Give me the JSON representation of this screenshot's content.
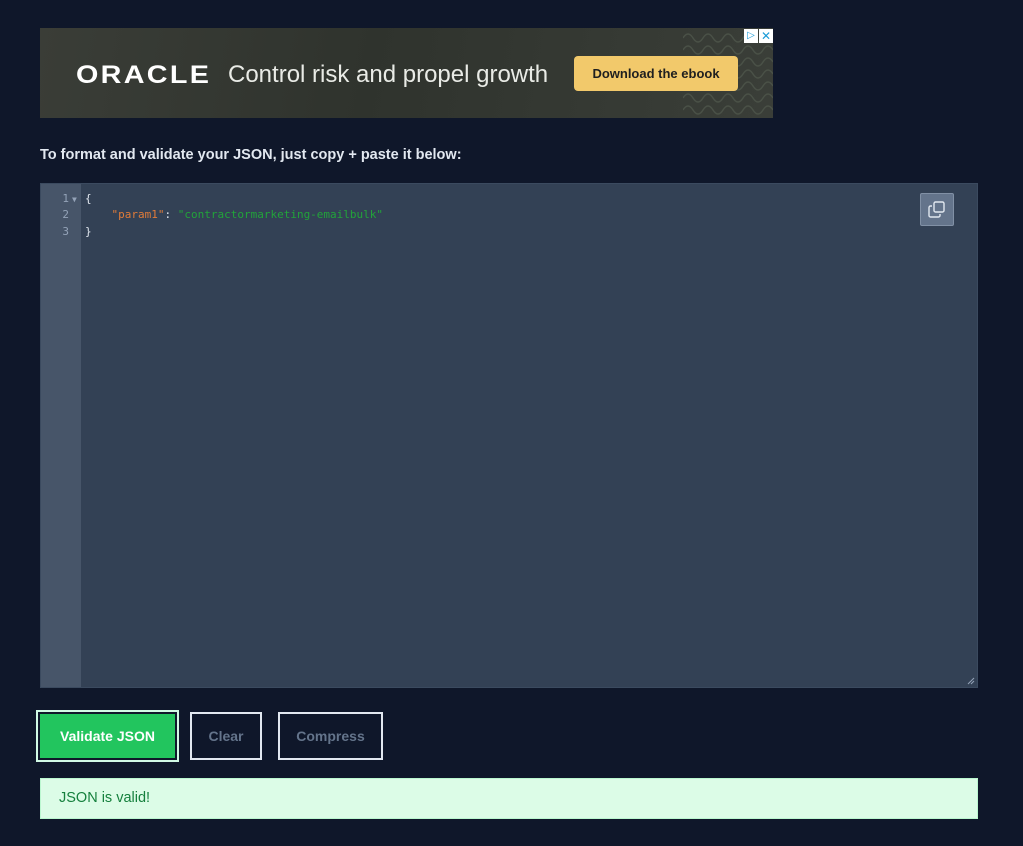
{
  "ad": {
    "logo": "ORACLE",
    "tagline": "Control risk and propel growth",
    "cta": "Download the ebook",
    "adchoices_icon": "adchoices-icon",
    "close_icon": "close-icon",
    "cta_color": "#f2c96b"
  },
  "instructions": "To format and validate your JSON, just copy + paste it below:",
  "editor": {
    "lines": [
      {
        "number": "1",
        "text": "{"
      },
      {
        "number": "2",
        "key": "\"param1\"",
        "sep": ": ",
        "value": "\"contractormarketing-emailbulk\""
      },
      {
        "number": "3",
        "text": "}"
      }
    ],
    "copy_icon": "copy-icon",
    "key_color": "#e07b39",
    "string_color": "#22a33a"
  },
  "buttons": {
    "validate": "Validate JSON",
    "clear": "Clear",
    "compress": "Compress"
  },
  "status": {
    "message": "JSON is valid!",
    "color": "#15803d"
  }
}
